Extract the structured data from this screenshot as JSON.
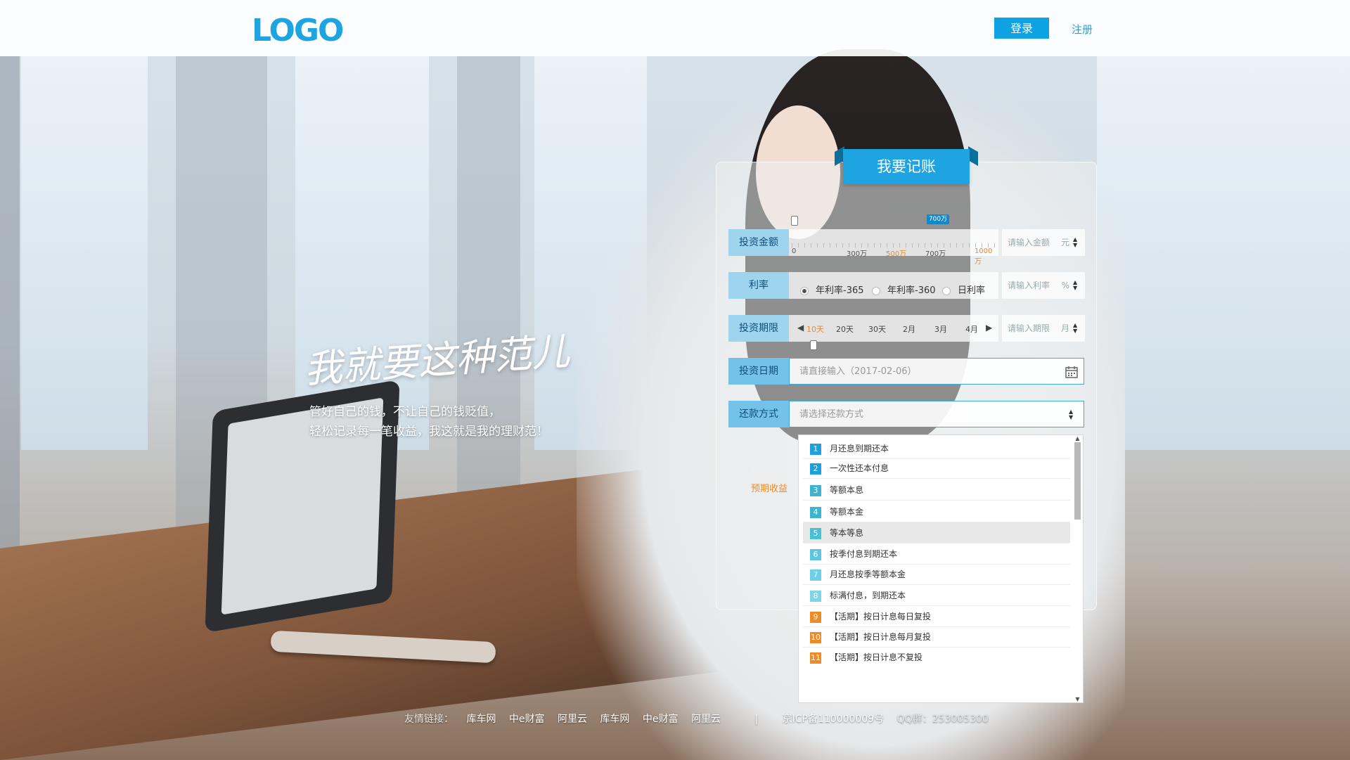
{
  "header": {
    "logo": "LOGO",
    "login": "登录",
    "register": "注册"
  },
  "hero": {
    "slogan": "我就要这种范儿",
    "line1": "管好自己的钱，不让自己的钱贬值，",
    "line2": "轻松记录每一笔收益，我这就是我的理财范！"
  },
  "panel": {
    "title": "我要记账",
    "amount": {
      "label": "投资金额",
      "slider_value": "700万",
      "slider_fraction": 0.7,
      "ticks": [
        "0",
        "300万",
        "500万",
        "700万",
        "1000万"
      ],
      "placeholder": "请输入金额",
      "unit": "元"
    },
    "rate": {
      "label": "利率",
      "options": [
        "年利率-365",
        "年利率-360",
        "日利率"
      ],
      "selected": "年利率-365",
      "placeholder": "请输入利率",
      "unit": "%"
    },
    "period": {
      "label": "投资期限",
      "options": [
        "10天",
        "20天",
        "30天",
        "2月",
        "3月",
        "4月"
      ],
      "selected": "10天",
      "placeholder": "请输入期限",
      "unit": "月"
    },
    "date": {
      "label": "投资日期",
      "placeholder": "请直接输入（2017-02-06）"
    },
    "repay": {
      "label": "还款方式",
      "placeholder": "请选择还款方式"
    },
    "earnings_label": "预期收益"
  },
  "dropdown": {
    "items": [
      {
        "num": "1",
        "text": "月还息到期还本",
        "color": "#1e9fe0"
      },
      {
        "num": "2",
        "text": "一次性还本付息",
        "color": "#1e9fe0"
      },
      {
        "num": "3",
        "text": "等额本息",
        "color": "#3fb4cf"
      },
      {
        "num": "4",
        "text": "等额本金",
        "color": "#3fb4cf"
      },
      {
        "num": "5",
        "text": "等本等息",
        "color": "#4bbfd6"
      },
      {
        "num": "6",
        "text": "按季付息到期还本",
        "color": "#5cc6e0"
      },
      {
        "num": "7",
        "text": "月还息按季等额本金",
        "color": "#6ccfe6"
      },
      {
        "num": "8",
        "text": "标满付息，到期还本",
        "color": "#7fd4ea"
      },
      {
        "num": "9",
        "text": "【活期】按日计息每日复投",
        "color": "#f08a24"
      },
      {
        "num": "10",
        "text": "【活期】按日计息每月复投",
        "color": "#f08a24"
      },
      {
        "num": "11",
        "text": "【活期】按日计息不复投",
        "color": "#f08a24"
      }
    ],
    "hovered_index": 4
  },
  "footer": {
    "links_label": "友情链接：",
    "links": [
      "库车网",
      "中e财富",
      "阿里云",
      "库车网",
      "中e财富",
      "阿里云"
    ],
    "separator": "|",
    "icp": "京ICP备110000009号",
    "qq": "QQ群：253005300"
  }
}
